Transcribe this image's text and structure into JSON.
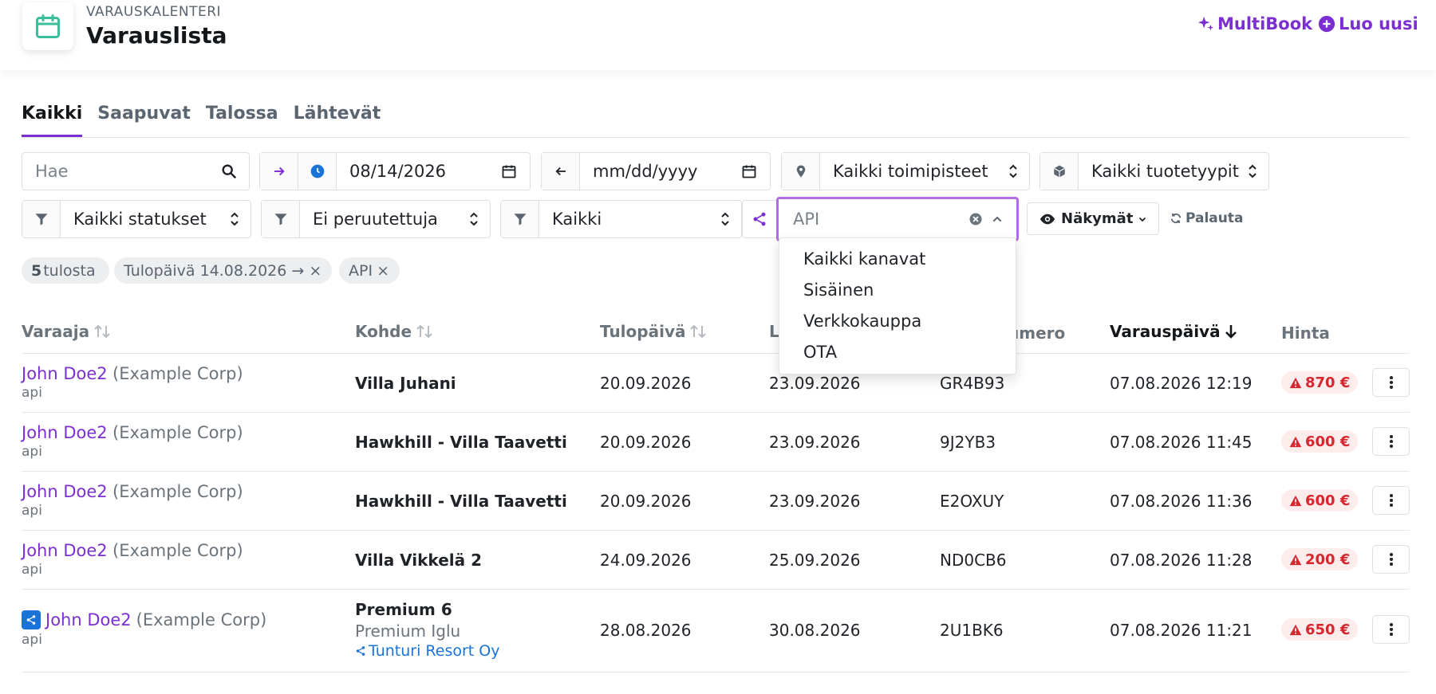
{
  "header": {
    "eyebrow": "VARAUSKALENTERI",
    "title": "Varauslista",
    "multibook": "MultiBook",
    "create_new": "Luo uusi"
  },
  "tabs": [
    "Kaikki",
    "Saapuvat",
    "Talossa",
    "Lähtevät"
  ],
  "filters": {
    "search_placeholder": "Hae",
    "arrival_date": "08/14/2026",
    "departure_placeholder": "mm/dd/yyyy",
    "location": "Kaikki toimipisteet",
    "product_type": "Kaikki tuotetyypit",
    "status": "Kaikki statukset",
    "cancellation": "Ei peruutettuja",
    "third": "Kaikki",
    "channel_input": "API",
    "views": "Näkymät",
    "reset": "Palauta"
  },
  "channel_options": [
    "Kaikki kanavat",
    "Sisäinen",
    "Verkkokauppa",
    "OTA"
  ],
  "chips": {
    "count": "5",
    "count_label": "tulosta",
    "date_chip": "Tulopäivä 14.08.2026 →",
    "api_chip": "API"
  },
  "table": {
    "headers": {
      "booker": "Varaaja",
      "target": "Kohde",
      "arrival": "Tulopäivä",
      "departure": "L",
      "number": "umero",
      "booking_date": "Varauspäivä",
      "price": "Hinta"
    },
    "rows": [
      {
        "name": "John Doe2",
        "corp": "(Example Corp)",
        "source": "api",
        "target": "Villa Juhani",
        "arrival": "20.09.2026",
        "departure": "23.09.2026",
        "number": "GR4B93",
        "booked": "07.08.2026 12:19",
        "price": "870 €"
      },
      {
        "name": "John Doe2",
        "corp": "(Example Corp)",
        "source": "api",
        "target": "Hawkhill - Villa Taavetti",
        "arrival": "20.09.2026",
        "departure": "23.09.2026",
        "number": "9J2YB3",
        "booked": "07.08.2026 11:45",
        "price": "600 €"
      },
      {
        "name": "John Doe2",
        "corp": "(Example Corp)",
        "source": "api",
        "target": "Hawkhill - Villa Taavetti",
        "arrival": "20.09.2026",
        "departure": "23.09.2026",
        "number": "E2OXUY",
        "booked": "07.08.2026 11:36",
        "price": "600 €"
      },
      {
        "name": "John Doe2",
        "corp": "(Example Corp)",
        "source": "api",
        "target": "Villa Vikkelä 2",
        "arrival": "24.09.2026",
        "departure": "25.09.2026",
        "number": "ND0CB6",
        "booked": "07.08.2026 11:28",
        "price": "200 €"
      },
      {
        "name": "John Doe2",
        "corp": "(Example Corp)",
        "source": "api",
        "target": "Premium 6",
        "target_sub": "Premium Iglu",
        "target_link": "Tunturi Resort Oy",
        "arrival": "28.08.2026",
        "departure": "30.08.2026",
        "number": "2U1BK6",
        "booked": "07.08.2026 11:21",
        "price": "650 €"
      }
    ]
  },
  "colors": {
    "accent": "#7c2fd1",
    "teal": "#3bbf9a",
    "price_red": "#d8262e",
    "link_blue": "#1a73d9"
  }
}
